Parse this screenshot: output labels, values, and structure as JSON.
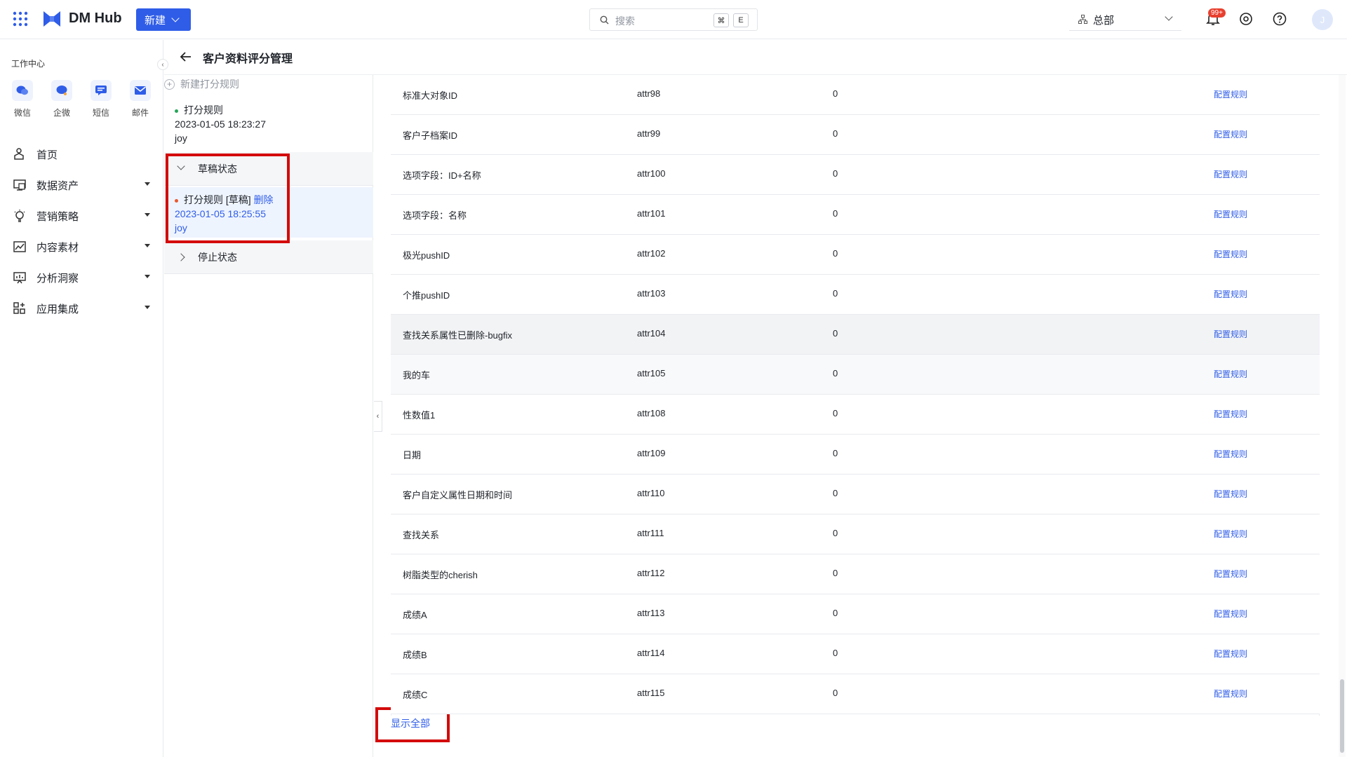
{
  "header": {
    "brand": "DM Hub",
    "new_button": "新建",
    "search_placeholder": "搜索",
    "shortcut_keys": [
      "⌘",
      "E"
    ],
    "org": "总部",
    "notification_badge": "99+",
    "avatar_initial": "J"
  },
  "sidebar": {
    "work_center_title": "工作中心",
    "quick_items": [
      {
        "label": "微信",
        "icon": "wechat-icon"
      },
      {
        "label": "企微",
        "icon": "wecom-icon"
      },
      {
        "label": "短信",
        "icon": "sms-icon"
      },
      {
        "label": "邮件",
        "icon": "mail-icon"
      }
    ],
    "menu": [
      {
        "label": "首页",
        "icon": "home-icon"
      },
      {
        "label": "数据资产",
        "icon": "data-asset-icon"
      },
      {
        "label": "营销策略",
        "icon": "bulb-icon"
      },
      {
        "label": "内容素材",
        "icon": "content-icon"
      },
      {
        "label": "分析洞察",
        "icon": "analysis-icon"
      },
      {
        "label": "应用集成",
        "icon": "apps-integration-icon"
      }
    ]
  },
  "page": {
    "title": "客户资料评分管理"
  },
  "rules": {
    "new_rule": "新建打分规则",
    "active_rule": {
      "name": "打分规则",
      "time": "2023-01-05 18:23:27",
      "user": "joy"
    },
    "draft_group": "草稿状态",
    "draft_rule": {
      "name": "打分规则 [草稿]",
      "delete": "删除",
      "time": "2023-01-05 18:25:55",
      "user": "joy"
    },
    "stopped_group": "停止状态"
  },
  "table": {
    "action_label": "配置规则",
    "rows": [
      {
        "name": "标准大对象ID",
        "attr": "attr98",
        "score": "0"
      },
      {
        "name": "客户子档案ID",
        "attr": "attr99",
        "score": "0"
      },
      {
        "name": "选项字段：ID+名称",
        "attr": "attr100",
        "score": "0"
      },
      {
        "name": "选项字段：名称",
        "attr": "attr101",
        "score": "0"
      },
      {
        "name": "极光pushID",
        "attr": "attr102",
        "score": "0"
      },
      {
        "name": "个推pushID",
        "attr": "attr103",
        "score": "0"
      },
      {
        "name": "查找关系属性已删除-bugfix",
        "attr": "attr104",
        "score": "0"
      },
      {
        "name": "我的车",
        "attr": "attr105",
        "score": "0"
      },
      {
        "name": "性数值1",
        "attr": "attr108",
        "score": "0"
      },
      {
        "name": "日期",
        "attr": "attr109",
        "score": "0"
      },
      {
        "name": "客户自定义属性日期和时间",
        "attr": "attr110",
        "score": "0"
      },
      {
        "name": "查找关系",
        "attr": "attr111",
        "score": "0"
      },
      {
        "name": "树脂类型的cherish",
        "attr": "attr112",
        "score": "0"
      },
      {
        "name": "成绩A",
        "attr": "attr113",
        "score": "0"
      },
      {
        "name": "成绩B",
        "attr": "attr114",
        "score": "0"
      },
      {
        "name": "成绩C",
        "attr": "attr115",
        "score": "0"
      }
    ],
    "show_all": "显示全部"
  },
  "colors": {
    "primary": "#2f5de8",
    "highlight_box": "#d40b0b",
    "active_dot": "#27a55a",
    "draft_dot": "#e8592f"
  }
}
